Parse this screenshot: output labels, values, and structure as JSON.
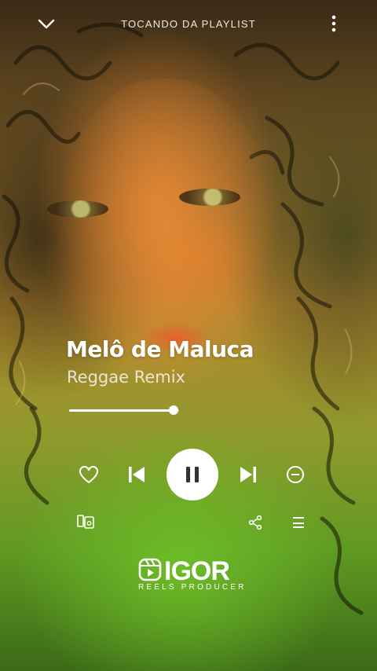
{
  "header": {
    "title": "TOCANDO DA PLAYLIST",
    "collapse_icon": "chevron-down-icon",
    "menu_icon": "more-vertical-icon"
  },
  "track": {
    "title": "Melô de Maluca",
    "subtitle": "Reggae Remix",
    "progress_fraction": 0.95
  },
  "controls": {
    "like_icon": "heart-icon",
    "previous_icon": "skip-previous-icon",
    "play_pause_icon": "pause-icon",
    "next_icon": "skip-next-icon",
    "remove_icon": "minus-circle-icon"
  },
  "secondary": {
    "devices_icon": "devices-icon",
    "share_icon": "share-icon",
    "queue_icon": "queue-icon"
  },
  "watermark": {
    "name": "IGOR",
    "tagline": "REELS PRODUCER"
  },
  "colors": {
    "text_primary": "#ffffff",
    "background_top": "#b9862e",
    "background_bottom": "#5f9a22"
  }
}
